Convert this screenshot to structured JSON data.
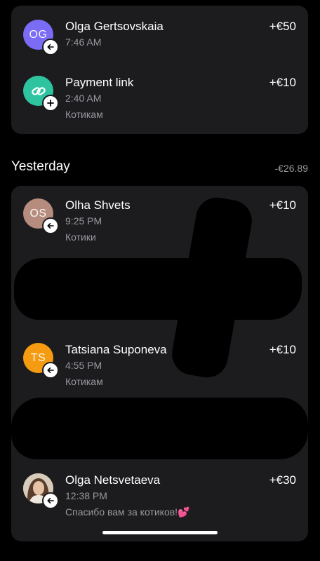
{
  "today": {
    "transactions": [
      {
        "initials": "OG",
        "name": "Olga Gertsovskaia",
        "time": "7:46 AM",
        "note": "",
        "amount": "+€50",
        "avatar_color": "#7b6cf6",
        "avatar_icon": "",
        "badge_icon": "arrow-left-icon"
      },
      {
        "initials": "",
        "name": "Payment link",
        "time": "2:40 AM",
        "note": "Котикам",
        "amount": "+€10",
        "avatar_color": "#2fc4a0",
        "avatar_icon": "link-icon",
        "badge_icon": "plus-icon"
      }
    ]
  },
  "yesterday": {
    "title": "Yesterday",
    "total": "-€26.89",
    "transactions": [
      {
        "initials": "OS",
        "name": "Olha Shvets",
        "time": "9:25 PM",
        "note": "Котики",
        "amount": "+€10",
        "avatar_color": "#b58c7e",
        "badge_icon": "arrow-left-icon"
      },
      {
        "initials": "TS",
        "name": "Tatsiana Suponeva",
        "time": "4:55 PM",
        "note": "Котикам",
        "amount": "+€10",
        "avatar_color": "#f59b12",
        "badge_icon": "arrow-left-icon"
      },
      {
        "initials": "",
        "name": "Olga Netsvetaeva",
        "time": "12:38 PM",
        "note": "Спасибо вам за котиков!💕",
        "amount": "+€30",
        "avatar_color": "#c9b9a6",
        "avatar_icon": "profile-photo",
        "badge_icon": "arrow-left-icon"
      }
    ]
  }
}
